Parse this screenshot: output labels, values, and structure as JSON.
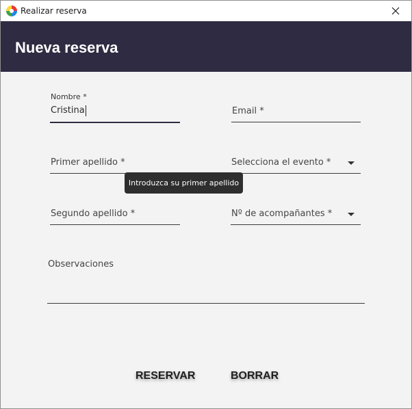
{
  "window": {
    "title": "Realizar reserva"
  },
  "header": {
    "title": "Nueva reserva"
  },
  "form": {
    "nombre": {
      "label": "Nombre *",
      "value": "Cristina"
    },
    "email": {
      "placeholder": "Email *"
    },
    "primer_apellido": {
      "placeholder": "Primer apellido *"
    },
    "evento": {
      "placeholder": "Selecciona el evento *"
    },
    "segundo_apellido": {
      "placeholder": "Segundo apellido *"
    },
    "acompanantes": {
      "placeholder": "Nº de acompañantes *"
    },
    "observaciones": {
      "placeholder": "Observaciones"
    }
  },
  "tooltip": {
    "text": "Introduzca su primer apellido"
  },
  "buttons": {
    "reservar": "RESERVAR",
    "borrar": "BORRAR"
  },
  "icons": {
    "app": "app-icon",
    "close": "close-icon",
    "dropdown": "chevron-down-icon"
  },
  "colors": {
    "header_bg": "#2f2b42",
    "window_bg": "#f3f3f3"
  }
}
